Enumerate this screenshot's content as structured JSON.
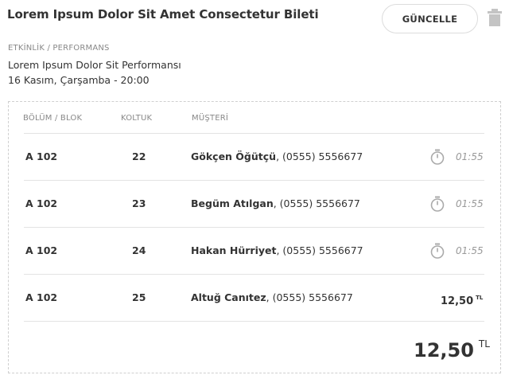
{
  "header": {
    "title": "Lorem Ipsum Dolor Sit Amet Consectetur Bileti",
    "update_label": "GÜNCELLE",
    "delete_icon": "trash-icon"
  },
  "event": {
    "label": "ETKİNLİK / PERFORMANS",
    "name": "Lorem Ipsum Dolor Sit Performansı",
    "date": "16 Kasım, Çarşamba - 20:00"
  },
  "table": {
    "headers": {
      "section": "BÖLÜM / BLOK",
      "seat": "KOLTUK",
      "customer": "MÜŞTERİ"
    },
    "rows": [
      {
        "section": "A 102",
        "seat": "22",
        "name": "Gökçen Öğütçü",
        "phone": ", (0555) 5556677",
        "status": "timer",
        "time": "01:55"
      },
      {
        "section": "A 102",
        "seat": "23",
        "name": "Begüm Atılgan",
        "phone": ", (0555) 5556677",
        "status": "timer",
        "time": "01:55"
      },
      {
        "section": "A 102",
        "seat": "24",
        "name": "Hakan Hürriyet",
        "phone": ", (0555) 5556677",
        "status": "timer",
        "time": "01:55"
      },
      {
        "section": "A 102",
        "seat": "25",
        "name": "Altuğ Canıtez",
        "phone": ", (0555) 5556677",
        "status": "price",
        "price": "12,50",
        "currency": "TL"
      }
    ]
  },
  "total": {
    "amount": "12,50",
    "currency": "TL"
  },
  "colors": {
    "text": "#333333",
    "muted": "#888888",
    "border": "#dcdcdc",
    "timer": "#aaaaaa"
  }
}
